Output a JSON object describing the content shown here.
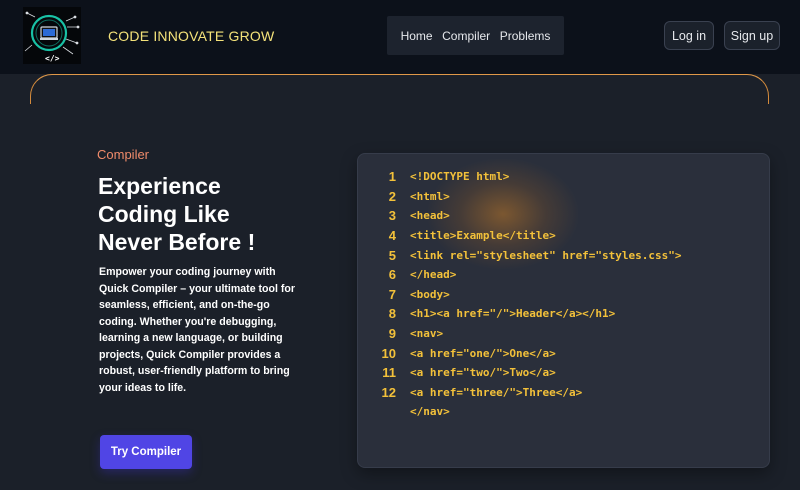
{
  "header": {
    "brand": "CODE INNOVATE GROW",
    "logo_text": "</>",
    "nav": [
      "Home",
      "Compiler",
      "Problems"
    ],
    "login_label": "Log in",
    "signup_label": "Sign up"
  },
  "hero": {
    "eyebrow": "Compiler",
    "title": "Experience Coding Like Never Before !",
    "description": "Empower your coding journey with Quick Compiler – your ultimate tool for seamless, efficient, and on-the-go coding. Whether you're debugging, learning a new language, or building projects, Quick Compiler provides a robust, user-friendly platform to bring your ideas to life.",
    "cta_label": "Try Compiler"
  },
  "code": {
    "lines": [
      {
        "num": "1",
        "text": "<!DOCTYPE html>"
      },
      {
        "num": "2",
        "text": "<html>"
      },
      {
        "num": "3",
        "text": "<head>"
      },
      {
        "num": "4",
        "text": "<title>Example</title>"
      },
      {
        "num": "5",
        "text": "<link rel=\"stylesheet\" href=\"styles.css\">"
      },
      {
        "num": "6",
        "text": "</head>"
      },
      {
        "num": "7",
        "text": "<body>"
      },
      {
        "num": "8",
        "text": "<h1><a href=\"/\">Header</a></h1>"
      },
      {
        "num": "9",
        "text": "<nav>"
      },
      {
        "num": "10",
        "text": "<a href=\"one/\">One</a>"
      },
      {
        "num": "11",
        "text": "<a href=\"two/\">Two</a>"
      },
      {
        "num": "12",
        "text": "<a href=\"three/\">Three</a>"
      },
      {
        "num": "",
        "text": "</nav>"
      }
    ]
  },
  "colors": {
    "background": "#1b2029",
    "header_bg": "#0c111a",
    "brand_text": "#f4e27a",
    "accent_orange": "#f08b6a",
    "cta_button": "#5045e5",
    "code_text": "#f3c13a",
    "code_panel_bg": "#2a2f3b"
  }
}
